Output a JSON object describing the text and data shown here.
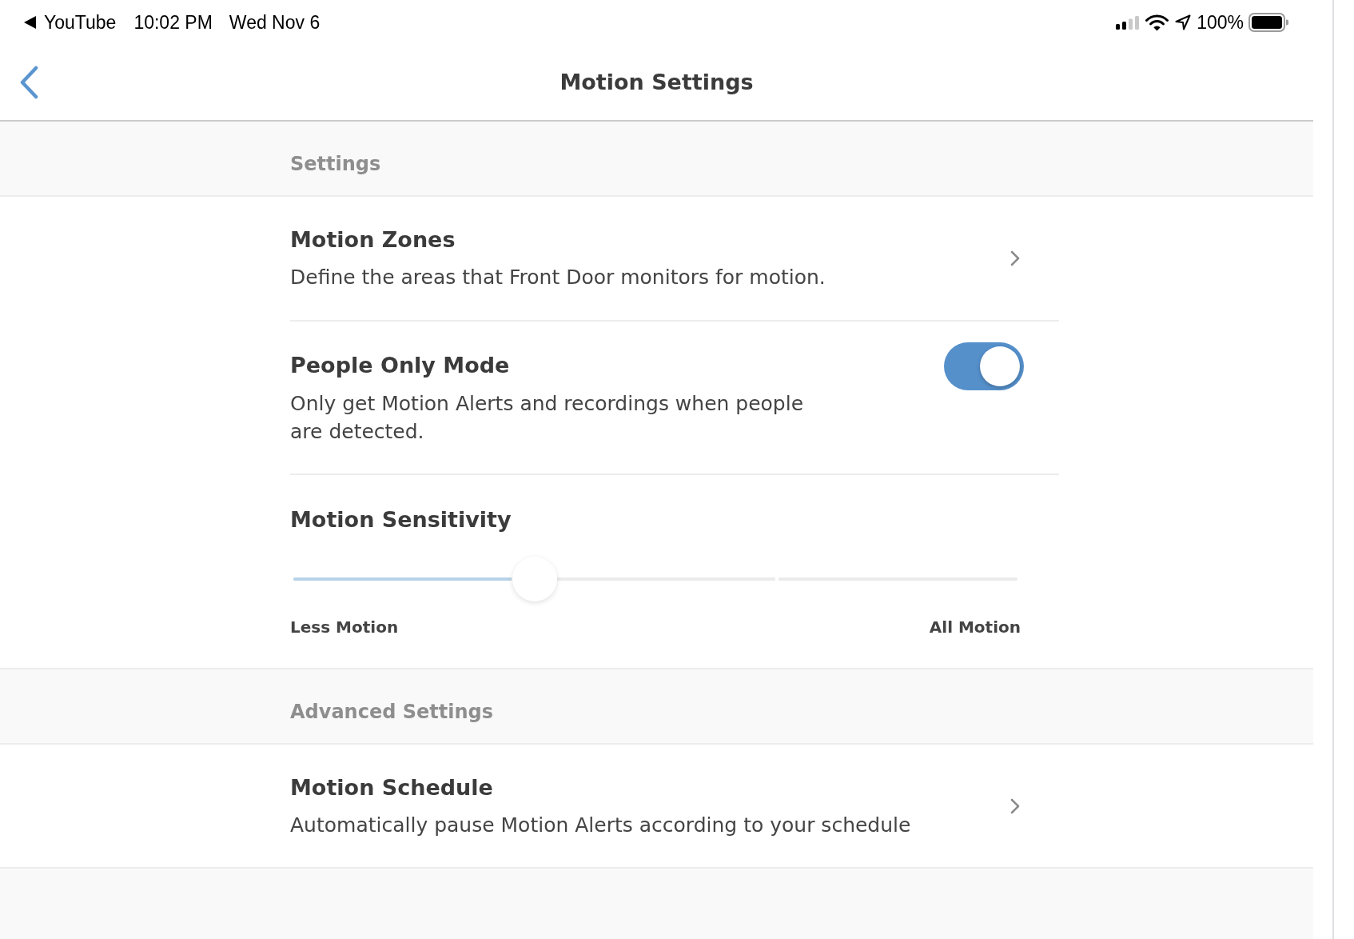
{
  "status_bar": {
    "back_app": "YouTube",
    "time": "10:02 PM",
    "date": "Wed Nov 6",
    "battery": "100%"
  },
  "nav": {
    "title": "Motion Settings"
  },
  "sections": [
    {
      "header": "Settings",
      "rows": [
        {
          "kind": "link",
          "title": "Motion Zones",
          "description": "Define the areas that Front Door monitors for motion."
        },
        {
          "kind": "toggle",
          "title": "People Only Mode",
          "description": "Only get Motion Alerts and recordings when people are detected.",
          "on": true
        },
        {
          "kind": "slider",
          "title": "Motion Sensitivity",
          "level": 0.333,
          "min_label": "Less Motion",
          "max_label": "All Motion"
        }
      ]
    },
    {
      "header": "Advanced Settings",
      "rows": [
        {
          "kind": "link",
          "title": "Motion Schedule",
          "description": "Automatically pause Motion Alerts according to your schedule"
        }
      ]
    }
  ]
}
